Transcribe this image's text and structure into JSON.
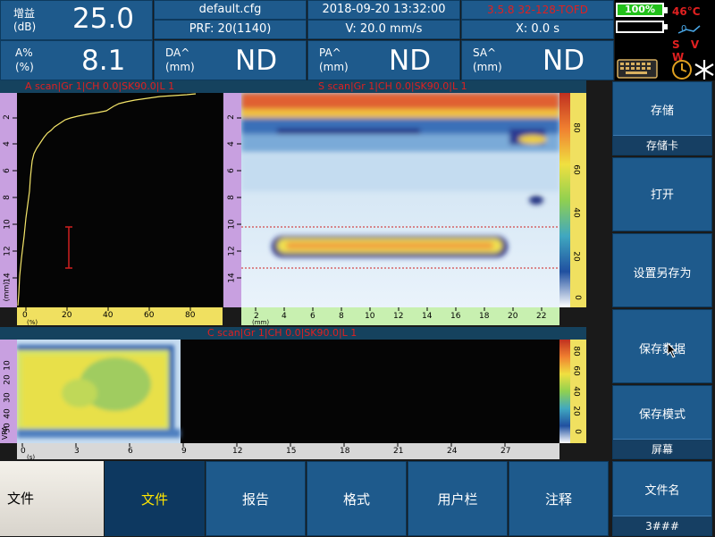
{
  "header": {
    "gain_label": "增益",
    "gain_unit": "(dB)",
    "gain_value": "25.0",
    "apct_label": "A%",
    "apct_unit": "(%)",
    "apct_value": "8.1",
    "file_name": "default.cfg",
    "prf": "PRF: 20(1140)",
    "datetime": "2018-09-20 13:32:00",
    "velocity": "V: 20.0 mm/s",
    "version": "3.5.8  32-128-TOFD",
    "x_pos": "X: 0.0  s",
    "da_label": "DA^",
    "da_unit": "(mm)",
    "da_value": "ND",
    "pa_label": "PA^",
    "pa_unit": "(mm)",
    "pa_value": "ND",
    "sa_label": "SA^",
    "sa_unit": "(mm)",
    "sa_value": "ND"
  },
  "status": {
    "battery1": "100%",
    "temperature": "46°C",
    "svw": "S V W",
    "keyboard_icon": "keyboard-icon",
    "clock_icon": "clock-icon",
    "snow_icon": "snowflake-icon",
    "status_color": "#e02020"
  },
  "views": {
    "ascan_title": "A scan|Gr 1|CH 0.0|SK90.0|L 1",
    "sscan_title": "S scan|Gr 1|CH 0.0|SK90.0|L 1",
    "cscan_title": "C scan|Gr 1|CH 0.0|SK90.0|L 1",
    "a_vert_ticks": [
      "2",
      "4",
      "6",
      "8",
      "10",
      "12",
      "14"
    ],
    "a_vert_unit": "(mm)",
    "a_horiz_ticks": [
      "0",
      "20",
      "40",
      "60",
      "80"
    ],
    "a_horiz_unit": "(%)",
    "s_vert_ticks": [
      "2",
      "4",
      "6",
      "8",
      "10",
      "12",
      "14"
    ],
    "s_vert_unit": "(mm)",
    "s_horiz_ticks": [
      "2",
      "4",
      "6",
      "8",
      "10",
      "12",
      "14",
      "16",
      "18",
      "20",
      "22"
    ],
    "s_horiz_unit": "(mm)",
    "s_cbar_ticks": [
      "80",
      "60",
      "40",
      "20",
      "0"
    ],
    "s_cbar_unit": "(%)",
    "c_vert_ticks": [
      "10",
      "20",
      "30",
      "40",
      "50"
    ],
    "c_vert_unit": "VPA",
    "c_horiz_ticks": [
      "0",
      "3",
      "6",
      "9",
      "12",
      "15",
      "18",
      "21",
      "24",
      "27"
    ],
    "c_horiz_unit": "(s)",
    "c_cbar_ticks": [
      "80",
      "60",
      "40",
      "20",
      "0"
    ],
    "c_cbar_unit": "(%)"
  },
  "right_panel": {
    "save_label": "存储",
    "save_sub": "存储卡",
    "open_label": "打开",
    "save_as_label": "设置另存为",
    "save_data_label": "保存数据",
    "save_mode_label": "保存模式",
    "save_mode_sub": "屏幕",
    "file_name_label": "文件名",
    "file_name_sub": "3###"
  },
  "bottom": {
    "menu_label": "文件",
    "tabs": [
      "文件",
      "报告",
      "格式",
      "用户栏",
      "注释"
    ]
  },
  "colors": {
    "accent": "#1e5a8c",
    "active_tab_text": "#ffe600",
    "ruler_purple": "#c8a0e0",
    "ruler_yellow": "#f0e060"
  }
}
